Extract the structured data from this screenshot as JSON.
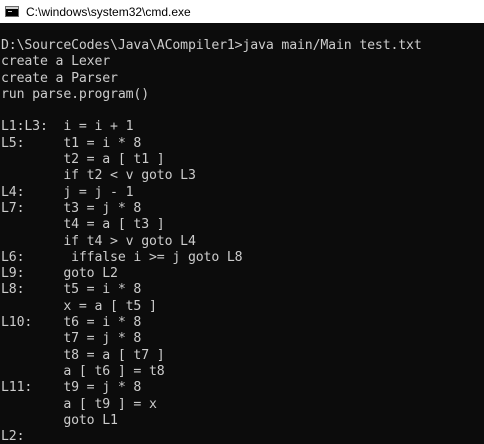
{
  "window": {
    "title": "C:\\windows\\system32\\cmd.exe",
    "icon": "cmd-icon"
  },
  "console": {
    "lines": [
      "D:\\SourceCodes\\Java\\ACompiler1>java main/Main test.txt",
      "create a Lexer",
      "create a Parser",
      "run parse.program()",
      "",
      "L1:L3:  i = i + 1",
      "L5:     t1 = i * 8",
      "        t2 = a [ t1 ]",
      "        if t2 < v goto L3",
      "L4:     j = j - 1",
      "L7:     t3 = j * 8",
      "        t4 = a [ t3 ]",
      "        if t4 > v goto L4",
      "L6:      iffalse i >= j goto L8",
      "L9:     goto L2",
      "L8:     t5 = i * 8",
      "        x = a [ t5 ]",
      "L10:    t6 = i * 8",
      "        t7 = j * 8",
      "        t8 = a [ t7 ]",
      "        a [ t6 ] = t8",
      "L11:    t9 = j * 8",
      "        a [ t9 ] = x",
      "        goto L1",
      "L2:"
    ]
  },
  "colors": {
    "console_bg": "#0c0c0c",
    "console_text": "#cccccc",
    "titlebar_bg": "#ffffff"
  }
}
